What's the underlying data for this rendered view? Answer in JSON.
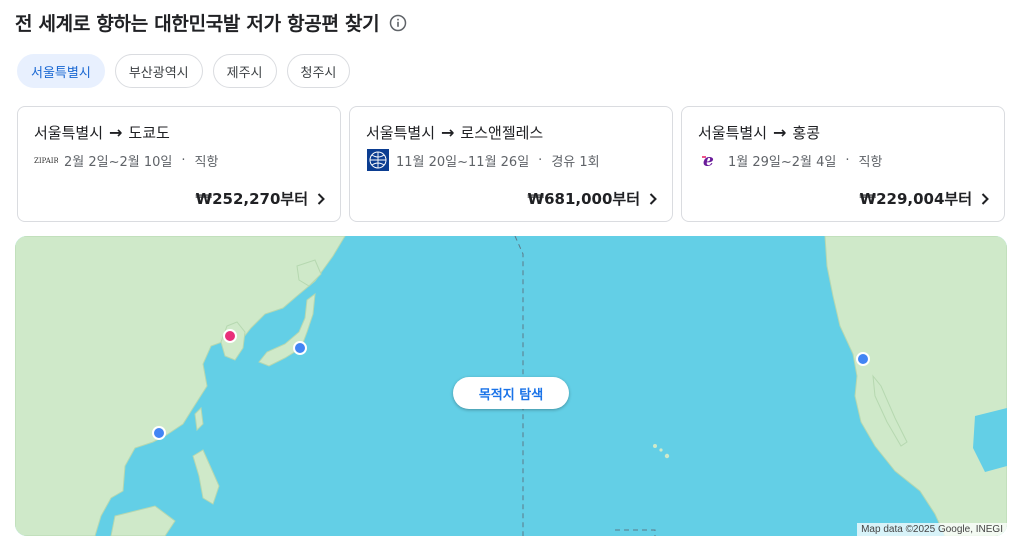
{
  "header": {
    "title": "전 세계로 향하는 대한민국발 저가 항공편 찾기",
    "info_icon": "info-icon"
  },
  "chips": [
    {
      "label": "서울특별시",
      "selected": true
    },
    {
      "label": "부산광역시",
      "selected": false
    },
    {
      "label": "제주시",
      "selected": false
    },
    {
      "label": "청주시",
      "selected": false
    }
  ],
  "cards": [
    {
      "origin": "서울특별시",
      "destination": "도쿄도",
      "dates": "2월 2일~2월 10일",
      "stops": "직항",
      "price": "₩252,270부터",
      "airline_logo": "zipair-logo"
    },
    {
      "origin": "서울특별시",
      "destination": "로스앤젤레스",
      "dates": "11월 20일~11월 26일",
      "stops": "경유 1회",
      "price": "₩681,000부터",
      "airline_logo": "united-logo"
    },
    {
      "origin": "서울특별시",
      "destination": "홍콩",
      "dates": "1월 29일~2월 4일",
      "stops": "직항",
      "price": "₩229,004부터",
      "airline_logo": "hk-express-logo"
    }
  ],
  "map": {
    "explore_label": "목적지 탐색",
    "attribution": "Map data ©2025 Google, INEGI",
    "colors": {
      "ocean": "#63cfe6",
      "land": "#cfe9c9",
      "origin_marker": "#e8307a",
      "destination_marker": "#4285f4"
    }
  },
  "symbols": {
    "arrow": "→",
    "dot": "·"
  },
  "colors": {
    "accent": "#1967d2",
    "chip_selected_bg": "#e8f0fe"
  }
}
